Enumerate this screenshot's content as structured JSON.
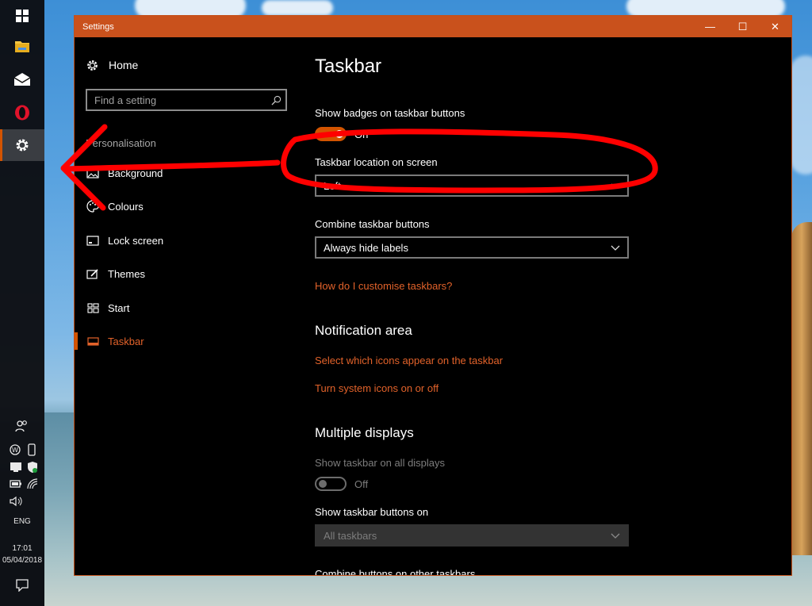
{
  "window": {
    "title": "Settings",
    "controls": {
      "minimize": "—",
      "maximize": "☐",
      "close": "✕"
    }
  },
  "nav": {
    "home": "Home",
    "search_placeholder": "Find a setting",
    "section": "Personalisation",
    "items": [
      {
        "label": "Background",
        "icon": "image-icon"
      },
      {
        "label": "Colours",
        "icon": "palette-icon"
      },
      {
        "label": "Lock screen",
        "icon": "lock-screen-icon"
      },
      {
        "label": "Themes",
        "icon": "themes-icon"
      },
      {
        "label": "Start",
        "icon": "start-icon"
      },
      {
        "label": "Taskbar",
        "icon": "taskbar-icon",
        "selected": true
      }
    ]
  },
  "content": {
    "title": "Taskbar",
    "badges": {
      "label": "Show badges on taskbar buttons",
      "state": "On"
    },
    "location": {
      "label": "Taskbar location on screen",
      "value": "Left"
    },
    "combine": {
      "label": "Combine taskbar buttons",
      "value": "Always hide labels"
    },
    "help_link": "How do I customise taskbars?",
    "notification": {
      "heading": "Notification area",
      "link1": "Select which icons appear on the taskbar",
      "link2": "Turn system icons on or off"
    },
    "multiple": {
      "heading": "Multiple displays",
      "show_all": {
        "label": "Show taskbar on all displays",
        "state": "Off"
      },
      "buttons_on": {
        "label": "Show taskbar buttons on",
        "value": "All taskbars"
      },
      "combine_other": {
        "label": "Combine buttons on other taskbars"
      }
    }
  },
  "taskbar": {
    "language": "ENG",
    "time": "17:01",
    "date": "05/04/2018"
  },
  "colors": {
    "accent": "#d35400",
    "link": "#e2622a",
    "annotation": "#ff0000"
  }
}
